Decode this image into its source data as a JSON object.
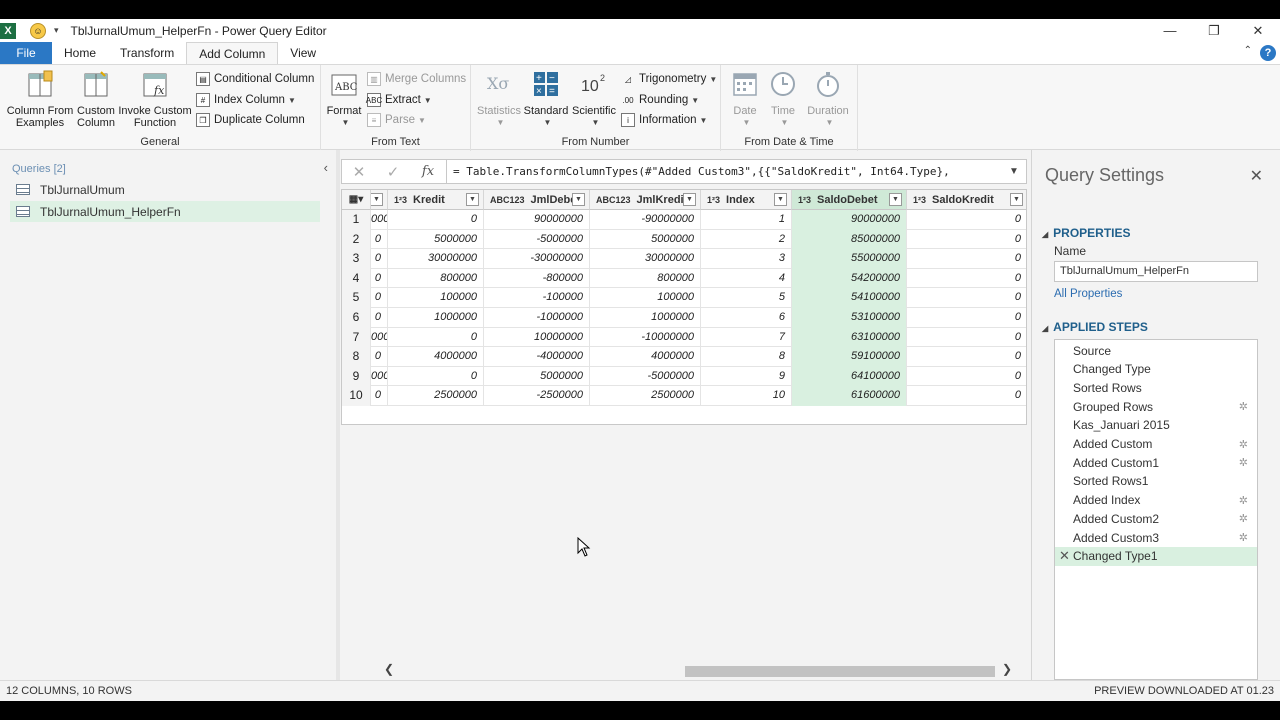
{
  "window": {
    "title": "TblJurnalUmum_HelperFn - Power Query Editor",
    "minimize": "—",
    "restore": "❐",
    "close": "✕"
  },
  "ribbon_tabs": [
    "File",
    "Home",
    "Transform",
    "Add Column",
    "View"
  ],
  "ribbon": {
    "general": {
      "label": "General",
      "column_from_examples": "Column From Examples",
      "custom_column": "Custom Column",
      "invoke_custom_function": "Invoke Custom Function",
      "conditional_column": "Conditional Column",
      "index_column": "Index Column",
      "duplicate_column": "Duplicate Column"
    },
    "from_text": {
      "label": "From Text",
      "format": "Format",
      "merge_columns": "Merge Columns",
      "extract": "Extract",
      "parse": "Parse"
    },
    "from_number": {
      "label": "From Number",
      "statistics": "Statistics",
      "standard": "Standard",
      "scientific": "Scientific",
      "trigonometry": "Trigonometry",
      "rounding": "Rounding",
      "information": "Information"
    },
    "from_date_time": {
      "label": "From Date & Time",
      "date": "Date",
      "time": "Time",
      "duration": "Duration"
    }
  },
  "queries": {
    "title": "Queries [2]",
    "items": [
      "TblJurnalUmum",
      "TblJurnalUmum_HelperFn"
    ],
    "selected": 1
  },
  "formula_bar": {
    "formula": "= Table.TransformColumnTypes(#\"Added Custom3\",{{\"SaldoKredit\", Int64.Type},"
  },
  "grid": {
    "columns": [
      {
        "name": "",
        "type": "1²3"
      },
      {
        "name": "Kredit",
        "type": "1²3"
      },
      {
        "name": "JmlDebet",
        "type": "ABC123"
      },
      {
        "name": "JmlKredit",
        "type": "ABC123"
      },
      {
        "name": "Index",
        "type": "1²3"
      },
      {
        "name": "SaldoDebet",
        "type": "1²3"
      },
      {
        "name": "SaldoKredit",
        "type": "1²3"
      }
    ],
    "rows": [
      {
        "n": "1",
        "c0": "000",
        "c1": "0",
        "c2": "90000000",
        "c3": "-90000000",
        "c4": "1",
        "c5": "90000000",
        "c6": "0"
      },
      {
        "n": "2",
        "c0": "0",
        "c1": "5000000",
        "c2": "-5000000",
        "c3": "5000000",
        "c4": "2",
        "c5": "85000000",
        "c6": "0"
      },
      {
        "n": "3",
        "c0": "0",
        "c1": "30000000",
        "c2": "-30000000",
        "c3": "30000000",
        "c4": "3",
        "c5": "55000000",
        "c6": "0"
      },
      {
        "n": "4",
        "c0": "0",
        "c1": "800000",
        "c2": "-800000",
        "c3": "800000",
        "c4": "4",
        "c5": "54200000",
        "c6": "0"
      },
      {
        "n": "5",
        "c0": "0",
        "c1": "100000",
        "c2": "-100000",
        "c3": "100000",
        "c4": "5",
        "c5": "54100000",
        "c6": "0"
      },
      {
        "n": "6",
        "c0": "0",
        "c1": "1000000",
        "c2": "-1000000",
        "c3": "1000000",
        "c4": "6",
        "c5": "53100000",
        "c6": "0"
      },
      {
        "n": "7",
        "c0": "000",
        "c1": "0",
        "c2": "10000000",
        "c3": "-10000000",
        "c4": "7",
        "c5": "63100000",
        "c6": "0"
      },
      {
        "n": "8",
        "c0": "0",
        "c1": "4000000",
        "c2": "-4000000",
        "c3": "4000000",
        "c4": "8",
        "c5": "59100000",
        "c6": "0"
      },
      {
        "n": "9",
        "c0": "000",
        "c1": "0",
        "c2": "5000000",
        "c3": "-5000000",
        "c4": "9",
        "c5": "64100000",
        "c6": "0"
      },
      {
        "n": "10",
        "c0": "0",
        "c1": "2500000",
        "c2": "-2500000",
        "c3": "2500000",
        "c4": "10",
        "c5": "61600000",
        "c6": "0"
      }
    ]
  },
  "settings": {
    "title": "Query Settings",
    "properties_header": "PROPERTIES",
    "name_label": "Name",
    "name_value": "TblJurnalUmum_HelperFn",
    "all_properties": "All Properties",
    "applied_steps_header": "APPLIED STEPS",
    "steps": [
      {
        "label": "Source",
        "gear": false
      },
      {
        "label": "Changed Type",
        "gear": false
      },
      {
        "label": "Sorted Rows",
        "gear": false
      },
      {
        "label": "Grouped Rows",
        "gear": true
      },
      {
        "label": "Kas_Januari 2015",
        "gear": false
      },
      {
        "label": "Added Custom",
        "gear": true
      },
      {
        "label": "Added Custom1",
        "gear": true
      },
      {
        "label": "Sorted Rows1",
        "gear": false
      },
      {
        "label": "Added Index",
        "gear": true
      },
      {
        "label": "Added Custom2",
        "gear": true
      },
      {
        "label": "Added Custom3",
        "gear": true
      },
      {
        "label": "Changed Type1",
        "gear": false,
        "selected": true
      }
    ]
  },
  "status": {
    "left": "12 COLUMNS, 10 ROWS",
    "right": "PREVIEW DOWNLOADED AT 01.23"
  }
}
